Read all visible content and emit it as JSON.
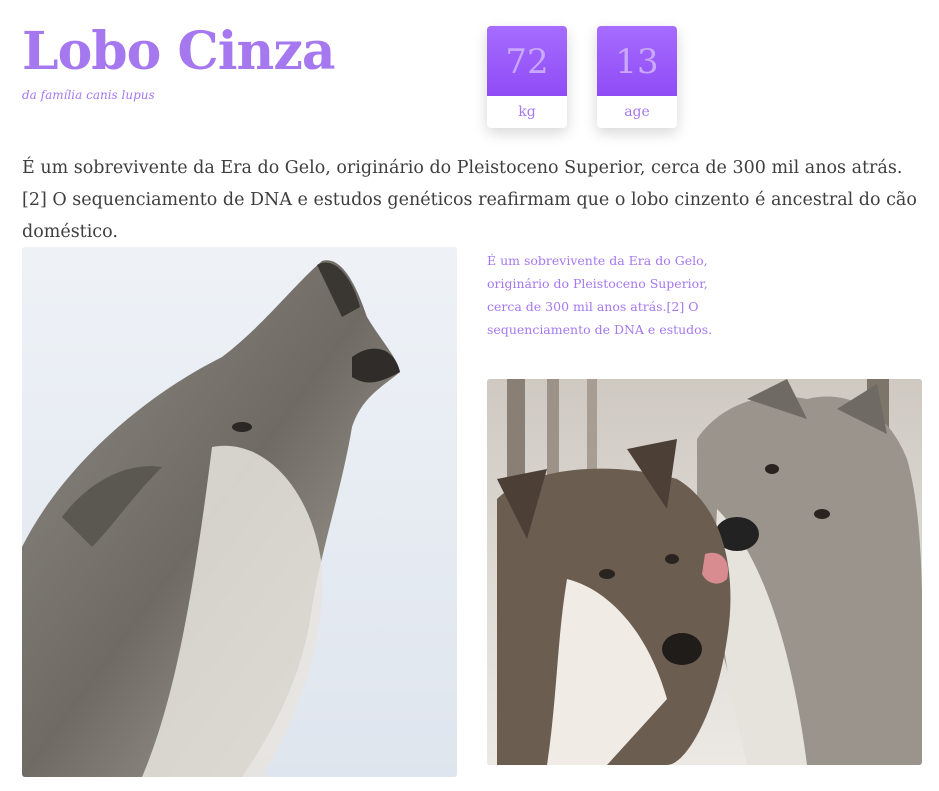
{
  "header": {
    "title": "Lobo Cinza",
    "subtitle": "da família canis lupus"
  },
  "stats": [
    {
      "value": "72",
      "unit": "kg"
    },
    {
      "value": "13",
      "unit": "age"
    }
  ],
  "intro_text": "É um sobrevivente da Era do Gelo, originário do Pleistoceno Superior, cerca de 300 mil anos atrás.[2] O sequenciamento de DNA e estudos genéticos reafirmam que o lobo cinzento é ancestral do cão doméstico.",
  "side_text": "É um sobrevivente da Era do Gelo, originário do Pleistoceno Superior, cerca de 300 mil anos atrás.[2] O sequenciamento de DNA e estudos.",
  "colors": {
    "accent": "#a678f0",
    "stat_gradient_top": "#a66cff",
    "stat_gradient_bottom": "#8f4cf5",
    "body_text": "#3e3e3e"
  }
}
